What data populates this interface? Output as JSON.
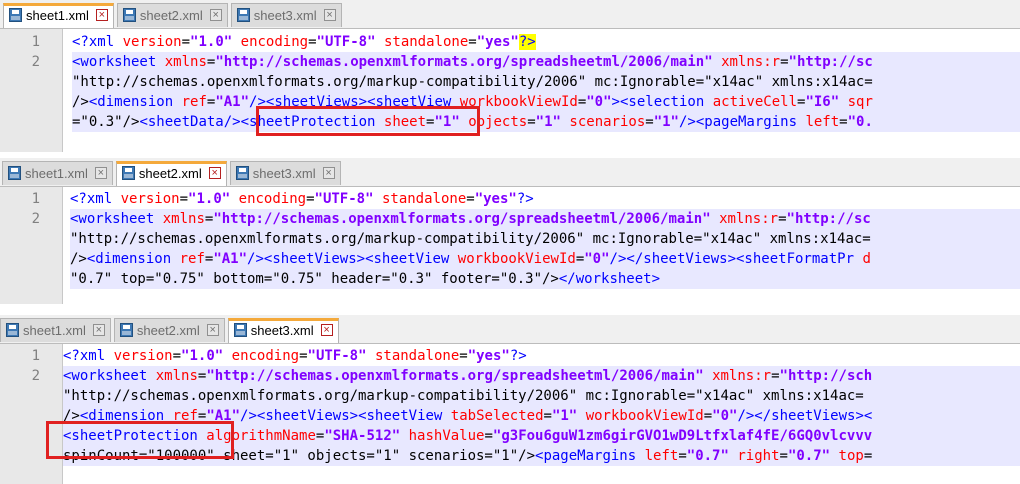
{
  "colors": {
    "tag": "#0000ff",
    "attribute": "#ff0000",
    "value": "#8000ff",
    "highlight_box": "#e02020",
    "active_tab_accent": "#f4a93b"
  },
  "panels": [
    {
      "tabs": [
        {
          "label": "sheet1.xml",
          "active": true
        },
        {
          "label": "sheet2.xml",
          "active": false
        },
        {
          "label": "sheet3.xml",
          "active": false
        }
      ],
      "lines": [
        {
          "num": "1",
          "text": "<?xml version=\"1.0\" encoding=\"UTF-8\" standalone=\"yes\"?>"
        },
        {
          "num": "2",
          "text": "<worksheet xmlns=\"http://schemas.openxmlformats.org/spreadsheetml/2006/main\" xmlns:r=\"http://sc"
        },
        {
          "num": "",
          "text": "\"http://schemas.openxmlformats.org/markup-compatibility/2006\" mc:Ignorable=\"x14ac\" xmlns:x14ac="
        },
        {
          "num": "",
          "text": "/><dimension ref=\"A1\"/><sheetViews><sheetView workbookViewId=\"0\"><selection activeCell=\"I6\" sqr"
        },
        {
          "num": "",
          "text": "=\"0.3\"/><sheetData/><sheetProtection sheet=\"1\" objects=\"1\" scenarios=\"1\"/><pageMargins left=\"0."
        }
      ]
    },
    {
      "tabs": [
        {
          "label": "sheet1.xml",
          "active": false
        },
        {
          "label": "sheet2.xml",
          "active": true
        },
        {
          "label": "sheet3.xml",
          "active": false
        }
      ],
      "lines": [
        {
          "num": "1",
          "text": "<?xml version=\"1.0\" encoding=\"UTF-8\" standalone=\"yes\"?>"
        },
        {
          "num": "2",
          "text": "<worksheet xmlns=\"http://schemas.openxmlformats.org/spreadsheetml/2006/main\" xmlns:r=\"http://sc"
        },
        {
          "num": "",
          "text": "\"http://schemas.openxmlformats.org/markup-compatibility/2006\" mc:Ignorable=\"x14ac\" xmlns:x14ac="
        },
        {
          "num": "",
          "text": "/><dimension ref=\"A1\"/><sheetViews><sheetView workbookViewId=\"0\"/></sheetViews><sheetFormatPr d"
        },
        {
          "num": "",
          "text": "\"0.7\" top=\"0.75\" bottom=\"0.75\" header=\"0.3\" footer=\"0.3\"/></worksheet>"
        }
      ]
    },
    {
      "tabs": [
        {
          "label": "sheet1.xml",
          "active": false
        },
        {
          "label": "sheet2.xml",
          "active": false
        },
        {
          "label": "sheet3.xml",
          "active": true
        }
      ],
      "lines": [
        {
          "num": "1",
          "text": "<?xml version=\"1.0\" encoding=\"UTF-8\" standalone=\"yes\"?>"
        },
        {
          "num": "2",
          "text": "<worksheet xmlns=\"http://schemas.openxmlformats.org/spreadsheetml/2006/main\" xmlns:r=\"http://sch"
        },
        {
          "num": "",
          "text": "\"http://schemas.openxmlformats.org/markup-compatibility/2006\" mc:Ignorable=\"x14ac\" xmlns:x14ac="
        },
        {
          "num": "",
          "text": "/><dimension ref=\"A1\"/><sheetViews><sheetView tabSelected=\"1\" workbookViewId=\"0\"/></sheetViews><"
        },
        {
          "num": "",
          "text": "<sheetProtection algorithmName=\"SHA-512\" hashValue=\"g3Fou6guW1zm6girGVO1wD9Ltfxlaf4fE/6GQ0vlcvvv"
        },
        {
          "num": "",
          "text": "spinCount=\"100000\" sheet=\"1\" objects=\"1\" scenarios=\"1\"/><pageMargins left=\"0.7\" right=\"0.7\" top="
        }
      ]
    }
  ]
}
